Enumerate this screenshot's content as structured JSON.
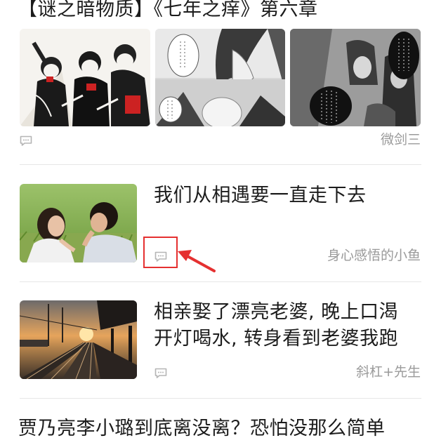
{
  "articles": [
    {
      "title": "【谜之暗物质】《七年之痒》第六章",
      "source": "微剑三",
      "comment_icon": "comment-icon",
      "thumbnails": [
        "propaganda-poster-image",
        "manga-panel-image",
        "manga-panel-image"
      ]
    },
    {
      "title": "我们从相遇要一直走下去",
      "source": "身心感悟的小鱼",
      "comment_icon": "comment-icon",
      "thumbnail": "couple-on-grass-photo"
    },
    {
      "title_line1": "相亲娶了漂亮老婆, 晚上口渴",
      "title_line2": "开灯喝水, 转身看到老婆我跑",
      "source": "斜杠+先生",
      "comment_icon": "comment-icon",
      "thumbnail": "railway-sunset-photo"
    },
    {
      "title": "贾乃亮李小璐到底离没离？恐怕没那么简单"
    }
  ],
  "annotation": {
    "box_color": "#e53030",
    "arrow_color": "#e53030"
  }
}
